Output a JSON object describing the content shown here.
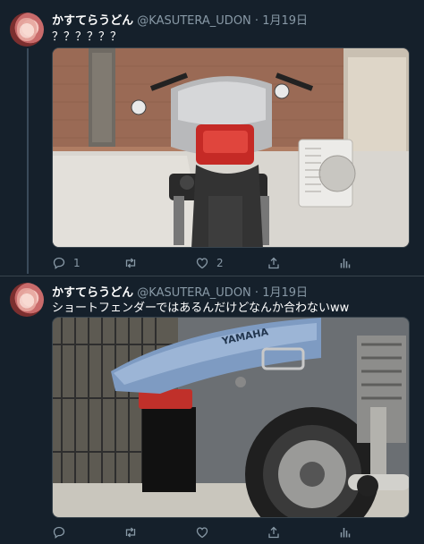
{
  "tweets": [
    {
      "name": "かすてらうどん",
      "handle": "@KASUTERA_UDON",
      "sep": "·",
      "date": "1月19日",
      "text": "？？？？？？",
      "image_alt": "バイクの後ろ姿",
      "replies": "1",
      "retweets": "",
      "likes": "2"
    },
    {
      "name": "かすてらうどん",
      "handle": "@KASUTERA_UDON",
      "sep": "·",
      "date": "1月19日",
      "text": "ショートフェンダーではあるんだけどなんか合わないww",
      "image_alt": "バイクのショートフェンダー",
      "replies": "",
      "retweets": "",
      "likes": ""
    }
  ],
  "icons": {
    "reply": "reply-icon",
    "retweet": "retweet-icon",
    "like": "heart-icon",
    "share": "share-icon",
    "analytics": "analytics-icon"
  },
  "colors": {
    "background": "#15202b",
    "secondary_text": "#8899a6",
    "border": "#38444d"
  }
}
